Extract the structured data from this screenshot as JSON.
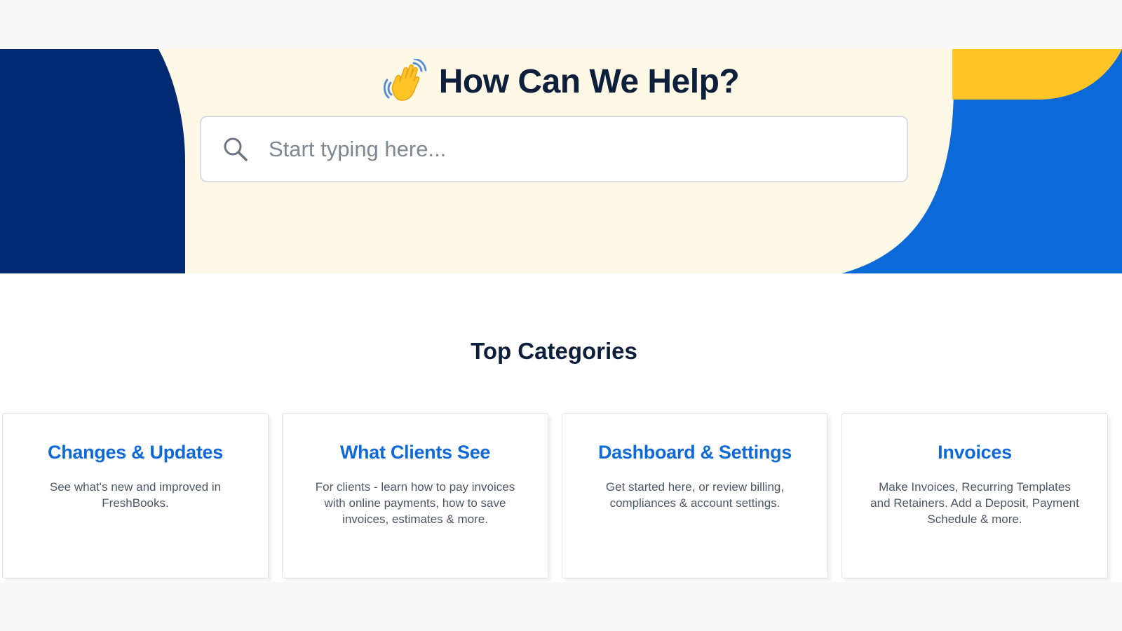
{
  "hero": {
    "title": "How Can We Help?",
    "wave_icon": "waving-hand-icon",
    "colors": {
      "background": "#fef8e7",
      "navy": "#012a72",
      "blue": "#0b6ad8",
      "yellow": "#ffc526",
      "title": "#0d1f3b"
    }
  },
  "search": {
    "placeholder": "Start typing here...",
    "value": "",
    "icon": "search-icon"
  },
  "categories": {
    "heading": "Top Categories",
    "items": [
      {
        "title": "Changes & Updates",
        "description": "See what's new and improved in FreshBooks."
      },
      {
        "title": "What Clients See",
        "description": "For clients - learn how to pay invoices with online payments, how to save invoices, estimates & more."
      },
      {
        "title": "Dashboard & Settings",
        "description": "Get started here, or review billing, compliances & account settings."
      },
      {
        "title": "Invoices",
        "description": "Make Invoices, Recurring Templates and Retainers. Add a Deposit, Payment Schedule & more."
      }
    ],
    "colors": {
      "card_title": "#0f6ad8",
      "card_text": "#4d5763"
    }
  }
}
